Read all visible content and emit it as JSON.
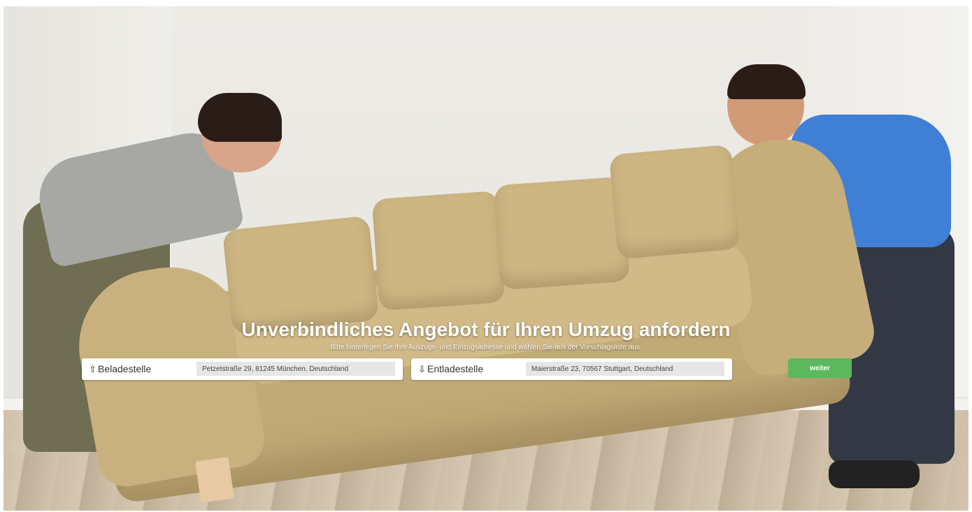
{
  "hero": {
    "title": "Unverbindliches Angebot für Ihren Umzug anfordern",
    "subtitle": "Bitte hinterlegen Sie Ihre Auszugs- und Einzugsadresse und wählen Sie aus der Vorschlagsliste aus."
  },
  "form": {
    "from": {
      "label": "Beladestelle",
      "icon": "loading-point-icon",
      "value": "Petzetstraße 29, 81245 München, Deutschland"
    },
    "to": {
      "label": "Entladestelle",
      "icon": "unloading-point-icon",
      "value": "Maierstraße 23, 70567 Stuttgart, Deutschland"
    },
    "submit_label": "weiter"
  },
  "colors": {
    "button": "#5cb85c",
    "title_text": "#ffffff",
    "input_bg": "#e6e6e6"
  }
}
